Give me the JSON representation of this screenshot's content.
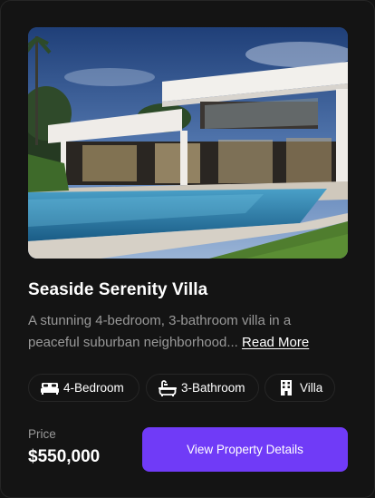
{
  "property": {
    "title": "Seaside Serenity Villa",
    "description": "A stunning 4-bedroom, 3-bathroom villa in a peaceful suburban neighborhood...",
    "read_more_label": "Read More",
    "features": [
      {
        "icon": "bed-icon",
        "label": "4-Bedroom"
      },
      {
        "icon": "bathtub-icon",
        "label": "3-Bathroom"
      },
      {
        "icon": "building-icon",
        "label": "Villa"
      }
    ],
    "price_label": "Price",
    "price_value": "$550,000",
    "cta_label": "View Property Details"
  },
  "colors": {
    "background": "#141414",
    "border": "#262626",
    "accent": "#703bf7",
    "muted_text": "#999999",
    "text": "#ffffff"
  }
}
